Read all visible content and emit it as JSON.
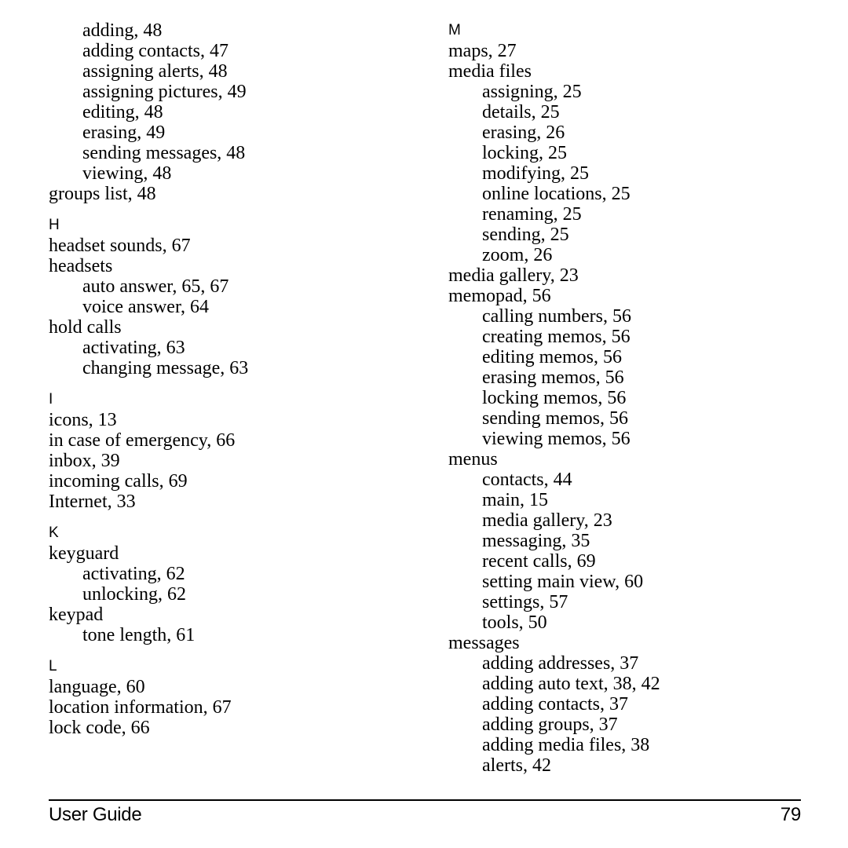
{
  "page": {
    "type": "book-index",
    "footer": {
      "left_label": "User Guide",
      "page_number": "79"
    }
  },
  "columns": {
    "left": [
      {
        "letter": "",
        "entries": [
          {
            "level": 1,
            "text": "adding, 48"
          },
          {
            "level": 1,
            "text": "adding contacts, 47"
          },
          {
            "level": 1,
            "text": "assigning alerts, 48"
          },
          {
            "level": 1,
            "text": "assigning pictures, 49"
          },
          {
            "level": 1,
            "text": "editing, 48"
          },
          {
            "level": 1,
            "text": "erasing, 49"
          },
          {
            "level": 1,
            "text": "sending messages, 48"
          },
          {
            "level": 1,
            "text": "viewing, 48"
          },
          {
            "level": 0,
            "text": "groups list, 48"
          }
        ]
      },
      {
        "letter": "H",
        "entries": [
          {
            "level": 0,
            "text": "headset sounds, 67"
          },
          {
            "level": 0,
            "text": "headsets"
          },
          {
            "level": 1,
            "text": "auto answer, 65, 67"
          },
          {
            "level": 1,
            "text": "voice answer, 64"
          },
          {
            "level": 0,
            "text": "hold calls"
          },
          {
            "level": 1,
            "text": "activating, 63"
          },
          {
            "level": 1,
            "text": "changing message, 63"
          }
        ]
      },
      {
        "letter": "I",
        "entries": [
          {
            "level": 0,
            "text": "icons, 13"
          },
          {
            "level": 0,
            "text": "in case of emergency, 66"
          },
          {
            "level": 0,
            "text": "inbox, 39"
          },
          {
            "level": 0,
            "text": "incoming calls, 69"
          },
          {
            "level": 0,
            "text": "Internet, 33"
          }
        ]
      },
      {
        "letter": "K",
        "entries": [
          {
            "level": 0,
            "text": "keyguard"
          },
          {
            "level": 1,
            "text": "activating, 62"
          },
          {
            "level": 1,
            "text": "unlocking, 62"
          },
          {
            "level": 0,
            "text": "keypad"
          },
          {
            "level": 1,
            "text": "tone length, 61"
          }
        ]
      },
      {
        "letter": "L",
        "entries": [
          {
            "level": 0,
            "text": "language, 60"
          },
          {
            "level": 0,
            "text": "location information, 67"
          },
          {
            "level": 0,
            "text": "lock code, 66"
          }
        ]
      }
    ],
    "right": [
      {
        "letter": "M",
        "entries": [
          {
            "level": 0,
            "text": "maps, 27"
          },
          {
            "level": 0,
            "text": "media files"
          },
          {
            "level": 1,
            "text": "assigning, 25"
          },
          {
            "level": 1,
            "text": "details, 25"
          },
          {
            "level": 1,
            "text": "erasing, 26"
          },
          {
            "level": 1,
            "text": "locking, 25"
          },
          {
            "level": 1,
            "text": "modifying, 25"
          },
          {
            "level": 1,
            "text": "online locations, 25"
          },
          {
            "level": 1,
            "text": "renaming, 25"
          },
          {
            "level": 1,
            "text": "sending, 25"
          },
          {
            "level": 1,
            "text": "zoom, 26"
          },
          {
            "level": 0,
            "text": "media gallery, 23"
          },
          {
            "level": 0,
            "text": "memopad, 56"
          },
          {
            "level": 1,
            "text": "calling numbers, 56"
          },
          {
            "level": 1,
            "text": "creating memos, 56"
          },
          {
            "level": 1,
            "text": "editing memos, 56"
          },
          {
            "level": 1,
            "text": "erasing memos, 56"
          },
          {
            "level": 1,
            "text": "locking memos, 56"
          },
          {
            "level": 1,
            "text": "sending memos, 56"
          },
          {
            "level": 1,
            "text": "viewing memos, 56"
          },
          {
            "level": 0,
            "text": "menus"
          },
          {
            "level": 1,
            "text": "contacts, 44"
          },
          {
            "level": 1,
            "text": "main, 15"
          },
          {
            "level": 1,
            "text": "media gallery, 23"
          },
          {
            "level": 1,
            "text": "messaging, 35"
          },
          {
            "level": 1,
            "text": "recent calls, 69"
          },
          {
            "level": 1,
            "text": "setting main view, 60"
          },
          {
            "level": 1,
            "text": "settings, 57"
          },
          {
            "level": 1,
            "text": "tools, 50"
          },
          {
            "level": 0,
            "text": "messages"
          },
          {
            "level": 1,
            "text": "adding addresses, 37"
          },
          {
            "level": 1,
            "text": "adding auto text, 38, 42"
          },
          {
            "level": 1,
            "text": "adding contacts, 37"
          },
          {
            "level": 1,
            "text": "adding groups, 37"
          },
          {
            "level": 1,
            "text": "adding media files, 38"
          },
          {
            "level": 1,
            "text": "alerts, 42"
          }
        ]
      }
    ]
  }
}
